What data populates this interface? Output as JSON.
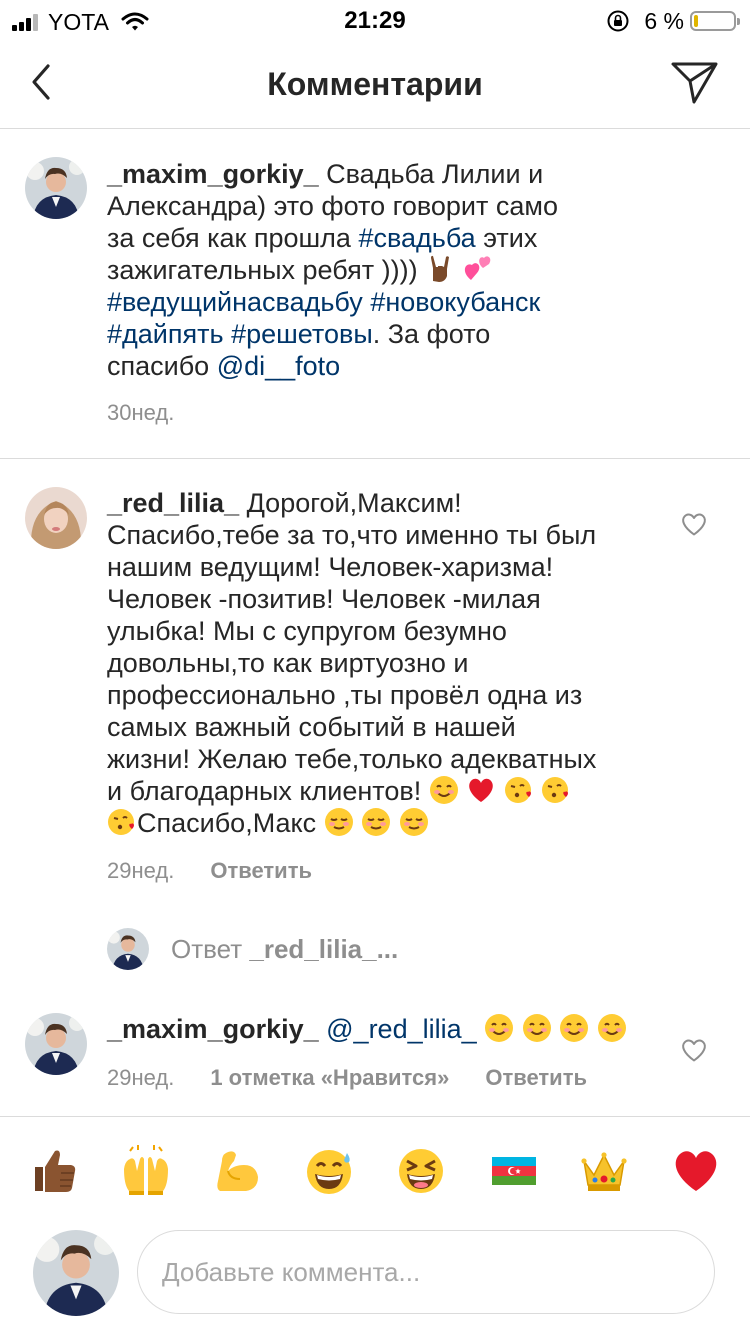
{
  "status_bar": {
    "carrier": "YOTA",
    "time": "21:29",
    "battery_pct": "6 %"
  },
  "header": {
    "title": "Комментарии"
  },
  "comments": [
    {
      "username": "_maxim_gorkiy_",
      "text1": "Свадьба Лилии и",
      "text2": "Александра)  это фото говорит само",
      "text3a": "за себя как прошла ",
      "tag_wedding": "#свадьба",
      "text3b": " этих",
      "text4": "зажигательных ребят ))))",
      "tag_host": "#ведущийнасвадьбу",
      "tag_city": "#новокубанск",
      "tag_five": "#дайпять",
      "tag_family": "#решетовы",
      "text6": ".  За фото",
      "text7": "спасибо ",
      "mention": "@di__foto",
      "time": "30нед."
    },
    {
      "username": "_red_lilia_",
      "line1": " Дорогой,Максим!",
      "line2": "Спасибо,тебе за то,что именно ты был",
      "line3": "нашим ведущим! Человек-харизма!",
      "line4": "Человек -позитив! Человек -милая",
      "line5": "улыбка! Мы с супругом безумно",
      "line6": "довольны,то как виртуозно и",
      "line7": "профессионально ,ты провёл одна из",
      "line8": "самых важный событий в нашей",
      "line9": "жизни! Желаю тебе,только адекватных",
      "line10": "и благодарных клиентов!",
      "line11": "Спасибо,Макс",
      "time": "29нед.",
      "reply": "Ответить"
    }
  ],
  "view_replies": {
    "prefix": "Ответ ",
    "user": "_red_lilia_..."
  },
  "reply_comment": {
    "username": "_maxim_gorkiy_",
    "mention": "@_red_lilia_",
    "time": "29нед.",
    "likes": "1 отметка «Нравится»",
    "reply": "Ответить"
  },
  "quick_emojis": [
    "thumbs-up",
    "raised-hands",
    "flexed-biceps",
    "grinning-sweat",
    "squinting-laugh",
    "azerbaijan-flag",
    "crown",
    "red-heart"
  ],
  "input": {
    "placeholder": "Добавьте коммента..."
  }
}
